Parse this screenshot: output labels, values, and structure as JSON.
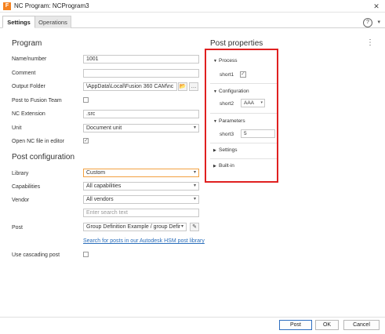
{
  "window": {
    "title": "NC Program: NCProgram3",
    "app_icon": "F"
  },
  "tabs": [
    {
      "label": "Settings"
    },
    {
      "label": "Operations"
    }
  ],
  "program": {
    "title": "Program",
    "name_label": "Name/number",
    "name_value": "1001",
    "comment_label": "Comment",
    "comment_value": "",
    "output_folder_label": "Output Folder",
    "output_folder_value": "\\AppData\\Local\\Fusion 360 CAM\\nc",
    "post_to_team_label": "Post to Fusion Team",
    "nc_extension_label": "NC Extension",
    "nc_extension_value": ".src",
    "unit_label": "Unit",
    "unit_value": "Document unit",
    "open_nc_label": "Open NC file in editor"
  },
  "post_configuration": {
    "title": "Post configuration",
    "library_label": "Library",
    "library_value": "Custom",
    "capabilities_label": "Capabilities",
    "capabilities_value": "All capabilities",
    "vendor_label": "Vendor",
    "vendor_value": "All vendors",
    "search_placeholder": "Enter search text",
    "post_label": "Post",
    "post_value": "Group Definition Example / group Defir",
    "search_link": "Search for posts in our Autodesk HSM post library",
    "cascading_label": "Use cascading post"
  },
  "post_properties": {
    "title": "Post properties",
    "groups": [
      {
        "label": "Process"
      },
      {
        "label": "Configuration"
      },
      {
        "label": "Parameters"
      },
      {
        "label": "Settings"
      },
      {
        "label": "Built-in"
      }
    ],
    "short1_label": "short1",
    "short2_label": "short2",
    "short2_value": "AAA",
    "short3_label": "short3",
    "short3_value": "5"
  },
  "footer": {
    "post_label": "Post",
    "ok_label": "OK",
    "cancel_label": "Cancel"
  },
  "icons": {
    "close": "✕",
    "caret": "▾",
    "expanded": "▼",
    "collapsed": "▶",
    "check": "✓",
    "folder": "📂",
    "ellipsis": "…",
    "pencil": "✎",
    "kebab": "⋮",
    "help": "?"
  },
  "colors": {
    "highlight_box": "#e02020",
    "link": "#2a6ebb",
    "app_icon": "#f58220"
  }
}
